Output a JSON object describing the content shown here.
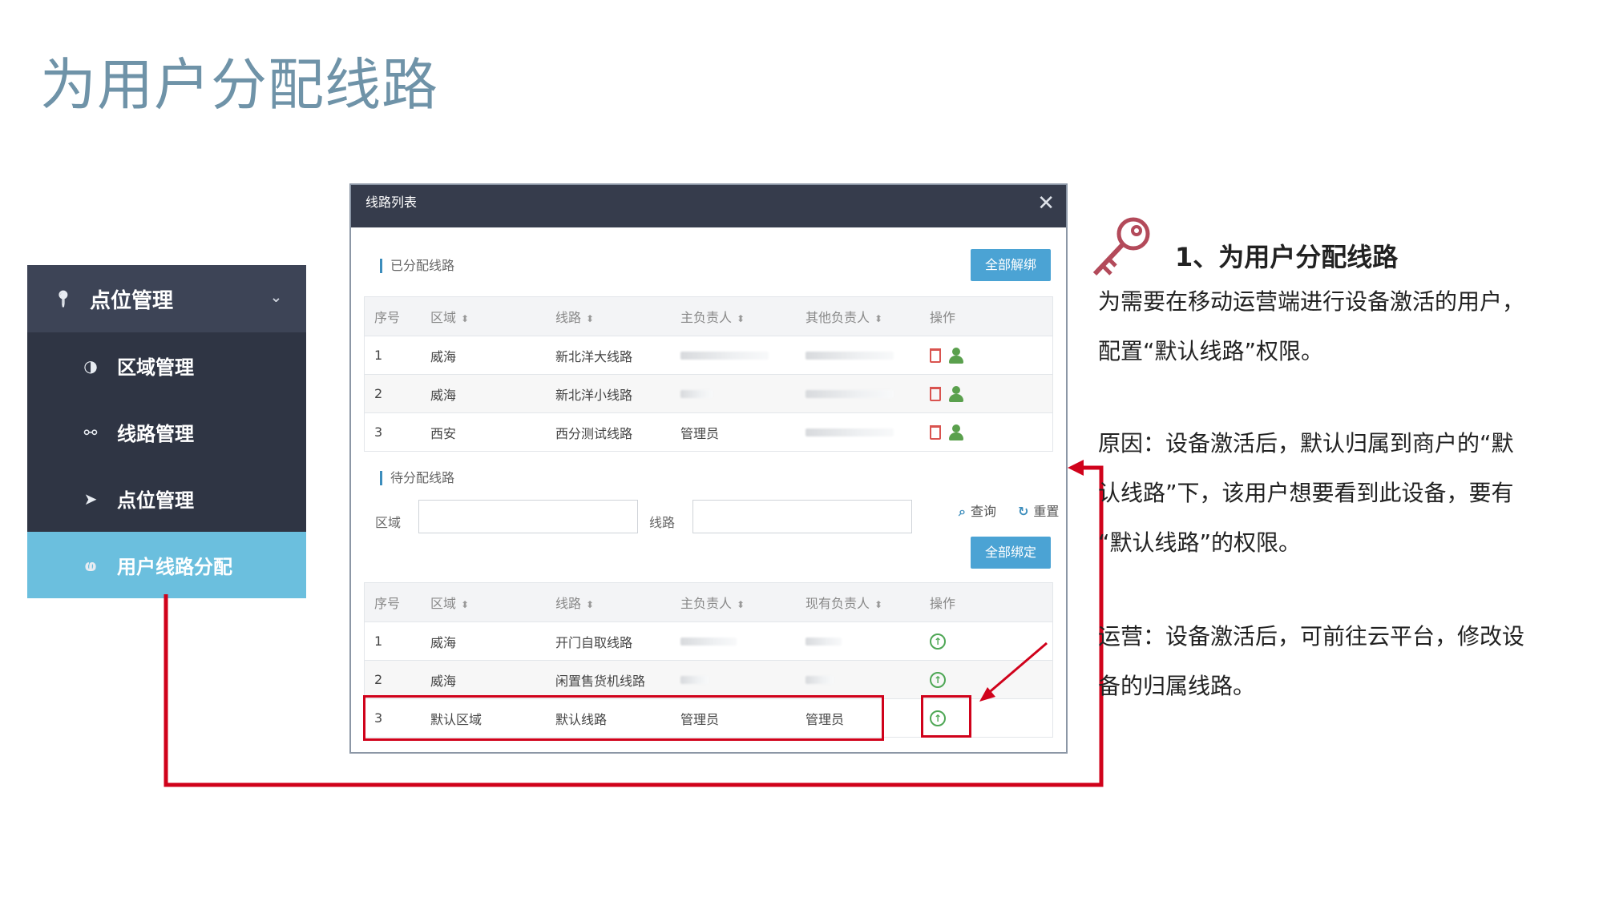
{
  "slide": {
    "title": "为用户分配线路"
  },
  "sidebar": {
    "header": {
      "label": "点位管理",
      "icon": "map-pin-icon"
    },
    "items": [
      {
        "label": "区域管理",
        "icon": "globe-icon"
      },
      {
        "label": "线路管理",
        "icon": "route-icon"
      },
      {
        "label": "点位管理",
        "icon": "location-arrow-icon"
      },
      {
        "label": "用户线路分配",
        "icon": "assign-icon",
        "active": true
      }
    ]
  },
  "dialog": {
    "title": "线路列表",
    "assigned": {
      "section_title": "已分配线路",
      "unbind_all": "全部解绑",
      "columns": [
        "序号",
        "区域",
        "线路",
        "主负责人",
        "其他负责人",
        "操作"
      ],
      "rows": [
        {
          "no": "1",
          "area": "威海",
          "route": "新北洋大线路"
        },
        {
          "no": "2",
          "area": "威海",
          "route": "新北洋小线路"
        },
        {
          "no": "3",
          "area": "西安",
          "route": "西分测试线路",
          "owner": "管理员"
        }
      ]
    },
    "pending": {
      "section_title": "待分配线路",
      "filter": {
        "area_label": "区域",
        "route_label": "线路",
        "query": "查询",
        "reset": "重置"
      },
      "bind_all": "全部绑定",
      "columns": [
        "序号",
        "区域",
        "线路",
        "主负责人",
        "现有负责人",
        "操作"
      ],
      "rows": [
        {
          "no": "1",
          "area": "威海",
          "route": "开门自取线路"
        },
        {
          "no": "2",
          "area": "威海",
          "route": "闲置售货机线路"
        },
        {
          "no": "3",
          "area": "默认区域",
          "route": "默认线路",
          "owner": "管理员",
          "current": "管理员"
        }
      ]
    }
  },
  "explain": {
    "step_title": "1、为用户分配线路",
    "p1_line1": "为需要在移动运营端进行设备激活的用户，",
    "p1_line2": "配置“默认线路”权限。",
    "p2_line1": "原因：设备激活后，默认归属到商户的“默",
    "p2_line2": "认线路”下，该用户想要看到此设备，要有",
    "p2_line3": "“默认线路”的权限。",
    "p3_line1": "运营：设备激活后，可前往云平台，修改设",
    "p3_line2": "备的归属线路。"
  },
  "colors": {
    "accent_red": "#d0021b",
    "sidebar_bg": "#2f3544",
    "active_item": "#6bbfde",
    "button_blue": "#4ba3d4",
    "title": "#6f93a8"
  }
}
